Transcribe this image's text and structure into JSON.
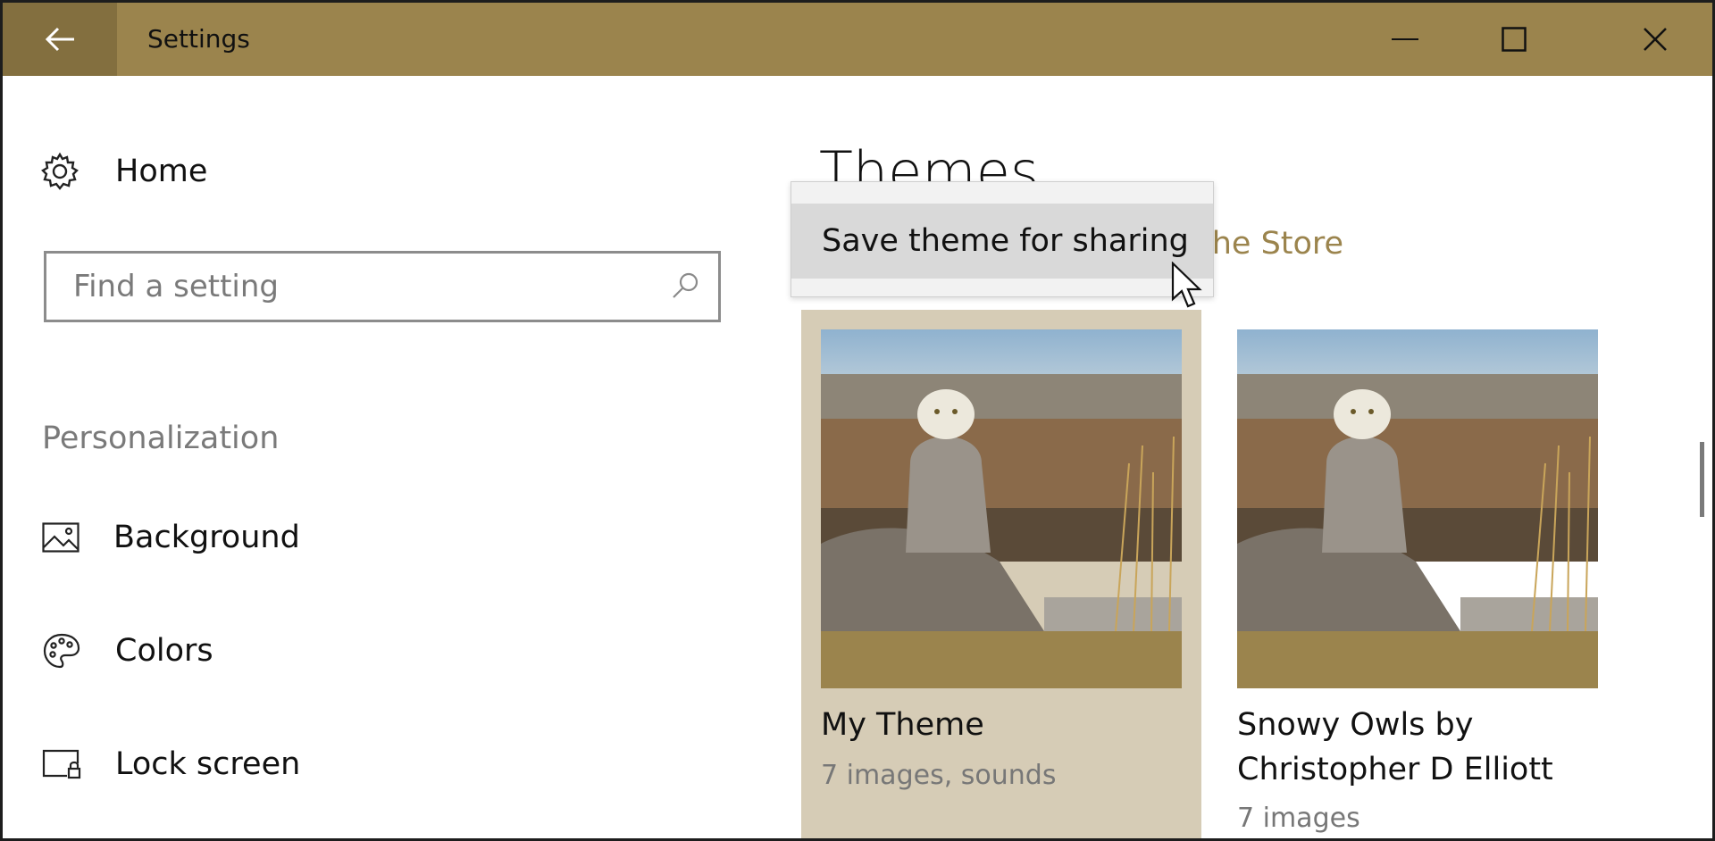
{
  "window": {
    "title": "Settings",
    "accent_color": "#9b844d"
  },
  "titlebar": {
    "back_icon": "arrow-left-icon",
    "minimize_icon": "minimize-icon",
    "maximize_icon": "maximize-icon",
    "close_icon": "close-icon"
  },
  "sidebar": {
    "home_label": "Home",
    "search_placeholder": "Find a setting",
    "section_header": "Personalization",
    "items": [
      {
        "label": "Background",
        "icon": "picture-icon"
      },
      {
        "label": "Colors",
        "icon": "palette-icon"
      },
      {
        "label": "Lock screen",
        "icon": "lock-screen-icon"
      }
    ]
  },
  "main": {
    "page_title": "Themes",
    "store_link_text": "the Store",
    "context_menu": {
      "items": [
        "Save theme for sharing"
      ]
    },
    "themes": [
      {
        "name": "My Theme",
        "meta": "7 images, sounds",
        "selected": true
      },
      {
        "name": "Snowy Owls by Christopher D Elliott",
        "meta": "7 images",
        "selected": false
      }
    ]
  }
}
